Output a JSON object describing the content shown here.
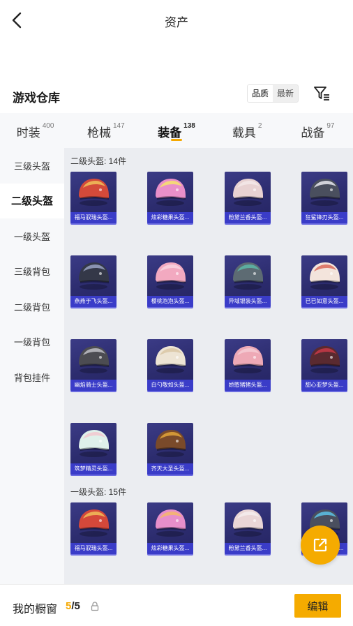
{
  "header": {
    "title": "资产"
  },
  "warehouse": {
    "title": "游戏仓库",
    "sort_options": [
      "品质",
      "最新"
    ]
  },
  "categories": [
    {
      "label": "时装",
      "count": "400"
    },
    {
      "label": "枪械",
      "count": "147"
    },
    {
      "label": "装备",
      "count": "138",
      "active": true
    },
    {
      "label": "载具",
      "count": "2"
    },
    {
      "label": "战备",
      "count": "97"
    }
  ],
  "sidebar": [
    {
      "label": "三级头盔"
    },
    {
      "label": "二级头盔",
      "active": true
    },
    {
      "label": "一级头盔"
    },
    {
      "label": "三级背包"
    },
    {
      "label": "二级背包"
    },
    {
      "label": "一级背包"
    },
    {
      "label": "背包挂件"
    }
  ],
  "sections": [
    {
      "title": "二级头盔: 14件",
      "items": [
        {
          "name": "福马驭瑞头盔...",
          "color": "#d44a3a",
          "accent": "#f0c05a"
        },
        {
          "name": "炫彩糖果头盔...",
          "color": "#e98fc9",
          "accent": "#f6e46b"
        },
        {
          "name": "粉黛兰香头盔...",
          "color": "#e8d2d2",
          "accent": "#f3e9e9"
        },
        {
          "name": "狂鲨锋刃头盔...",
          "color": "#4a4f5e",
          "accent": "#e8e8ee"
        },
        {
          "name": "燕燕于飞头盔...",
          "color": "#343848",
          "accent": "#9aa3c4"
        },
        {
          "name": "樱桃泡泡头盔...",
          "color": "#f2a9c0",
          "accent": "#f9d3df"
        },
        {
          "name": "异域银装头盔...",
          "color": "#5d6b73",
          "accent": "#5cb9a8"
        },
        {
          "name": "已已如意头盔...",
          "color": "#f3e4dc",
          "accent": "#d86a5a"
        },
        {
          "name": "幽焰骑士头盔...",
          "color": "#4c4c52",
          "accent": "#bfbfc6"
        },
        {
          "name": "白勺敬如头盔...",
          "color": "#ede4d4",
          "accent": "#d9c7a4"
        },
        {
          "name": "娇憨猪猪头盔...",
          "color": "#eea9b6",
          "accent": "#f5cdd5"
        },
        {
          "name": "甜心亚梦头盔...",
          "color": "#5a2a30",
          "accent": "#c83a48"
        },
        {
          "name": "筑梦精灵头盔...",
          "color": "#dff0ea",
          "accent": "#f3c7cf"
        },
        {
          "name": "齐天大圣头盔...",
          "color": "#7a4a2a",
          "accent": "#e2a43a"
        }
      ]
    },
    {
      "title": "一级头盔: 15件",
      "items": [
        {
          "name": "福马驭瑞头盔...",
          "color": "#d4483a",
          "accent": "#f0c05a"
        },
        {
          "name": "炫彩糖果头盔...",
          "color": "#e78fca",
          "accent": "#f4b86a"
        },
        {
          "name": "粉黛兰香头盔...",
          "color": "#ead6d6",
          "accent": "#f5eded"
        },
        {
          "name": "狂鲨锋刃头盔...",
          "color": "#4a4f5e",
          "accent": "#5cc2e6"
        }
      ]
    }
  ],
  "bottom": {
    "label": "我的橱窗",
    "count_current": "5",
    "count_sep": "/",
    "count_total": "5",
    "edit_label": "编辑"
  },
  "colors": {
    "accent": "#f5ab00",
    "card": "#2c2c6e",
    "name_bar": "#3a3cc8"
  },
  "icons": [
    "back-arrow-icon",
    "filter-icon",
    "lock-icon",
    "share-icon"
  ]
}
